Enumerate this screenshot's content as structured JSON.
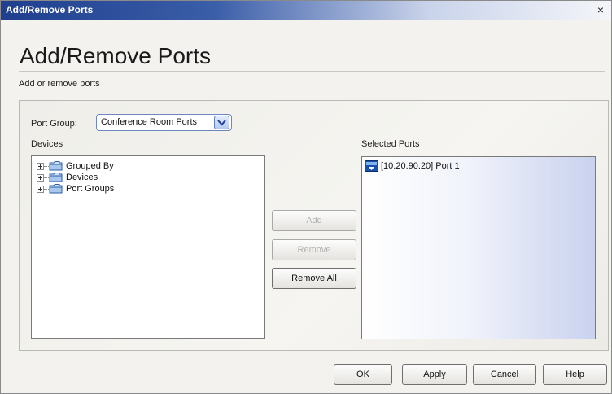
{
  "window": {
    "title": "Add/Remove Ports",
    "close_glyph": "×"
  },
  "heading": "Add/Remove Ports",
  "subtitle": "Add or remove ports",
  "port_group": {
    "label": "Port Group:",
    "selected": "Conference Room Ports"
  },
  "devices": {
    "label": "Devices",
    "tree": [
      {
        "label": "Grouped By",
        "icon": "folder-icon"
      },
      {
        "label": "Devices",
        "icon": "folder-icon"
      },
      {
        "label": "Port Groups",
        "icon": "folder-icon"
      }
    ]
  },
  "actions": {
    "add": "Add",
    "remove": "Remove",
    "remove_all": "Remove All"
  },
  "selected_ports": {
    "label": "Selected Ports",
    "items": [
      {
        "label": "[10.20.90.20] Port 1",
        "icon": "port-icon"
      }
    ]
  },
  "footer": {
    "ok": "OK",
    "apply": "Apply",
    "cancel": "Cancel",
    "help": "Help"
  },
  "colors": {
    "titlebar_start": "#1f3f8e",
    "dialog_bg": "#f3f2ee",
    "selected_pane_tint": "#c9d2ee"
  }
}
